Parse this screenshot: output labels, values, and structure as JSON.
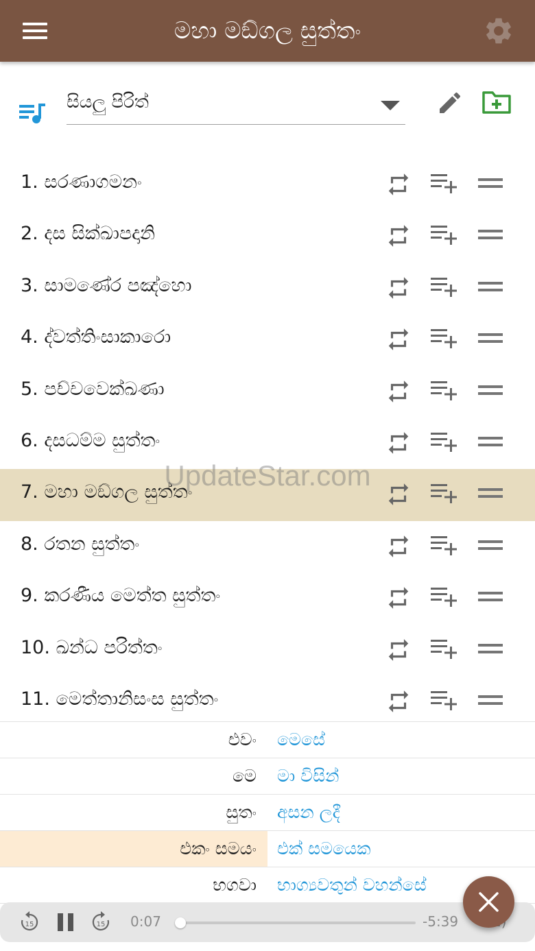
{
  "app_bar": {
    "title": "මහා මඞ්ගල සුත්තං",
    "menu_icon": "hamburger-menu-icon",
    "settings_icon": "gear-icon"
  },
  "playlist": {
    "icon": "queue-music-icon",
    "selected": "සියලු පිරිත්",
    "edit_icon": "pencil-icon",
    "add_folder_icon": "folder-plus-icon"
  },
  "tracks": [
    {
      "label": "1. සරණාගමනං"
    },
    {
      "label": "2. දස සික්ඛාපදානි"
    },
    {
      "label": "3. සාමණේර පඤ්හො"
    },
    {
      "label": "4. ද්වත්තිංසාකාරො"
    },
    {
      "label": "5. පච්චවෙක්ඛණා"
    },
    {
      "label": "6. දසධම්ම සුත්තං"
    },
    {
      "label": "7. මහා මඞ්ගල සුත්තං",
      "active": true
    },
    {
      "label": "8. රතන සුත්තං"
    },
    {
      "label": "9. කරණීය මෙත්ත සුත්තං"
    },
    {
      "label": "10. ඛන්ධ පරිත්තං"
    },
    {
      "label": "11. මෙත්තානිසංස සුත්තං"
    }
  ],
  "watermark": "UpdateStar.com",
  "translation": [
    {
      "pali": "එවං",
      "sinhala": "මෙසේ"
    },
    {
      "pali": "මෙ",
      "sinhala": "මා විසින්"
    },
    {
      "pali": "සුතං",
      "sinhala": "අසන ලදී"
    },
    {
      "pali": "එකං සමයං",
      "sinhala": "එක් සමයෙක",
      "highlight": true
    },
    {
      "pali": "භගවා",
      "sinhala": "භාග්‍යවතුන් වහන්සේ"
    }
  ],
  "player": {
    "current_time": "0:07",
    "remaining_time": "-5:39",
    "speed": "1)",
    "progress": 0.02,
    "rewind_label": "15",
    "forward_label": "15"
  },
  "colors": {
    "app_bar": "#7a5542",
    "accent_blue": "#2196d8",
    "active_row": "#e7dcbf",
    "highlight_cell": "#fdebd3",
    "folder_green": "#3a9a3a"
  }
}
